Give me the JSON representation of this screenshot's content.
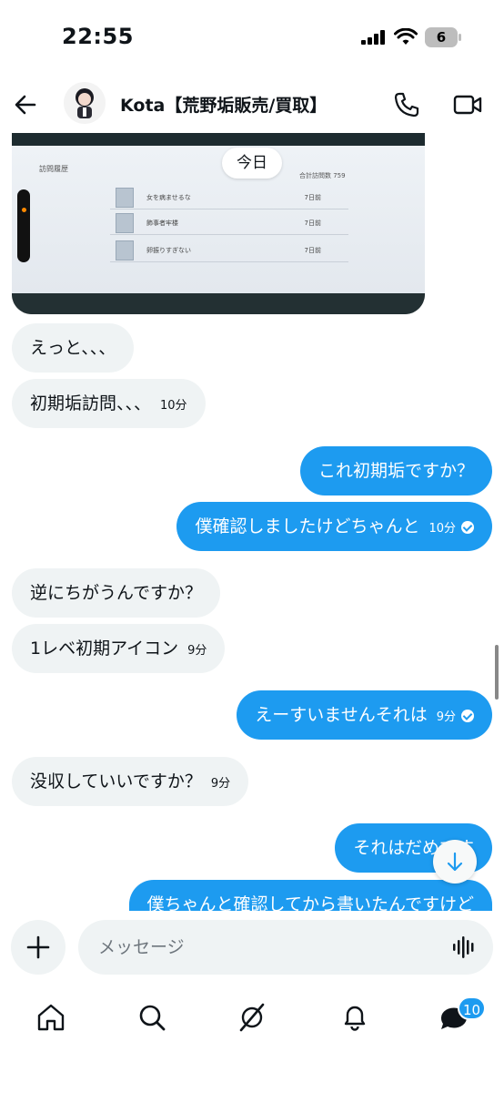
{
  "status_bar": {
    "time": "22:55",
    "battery": "6"
  },
  "header": {
    "contact_name": "Kota【荒野垢販売/買取】"
  },
  "image_message": {
    "panel_title": "訪問履歴",
    "total_label": "合計訪問数 759",
    "rows": [
      {
        "name": "女を病ませるな",
        "days": "7日前"
      },
      {
        "name": "飾事者牢楼",
        "days": "7日前"
      },
      {
        "name": "卵振りすぎない",
        "days": "7日前"
      }
    ]
  },
  "date_divider": "今日",
  "messages": [
    {
      "side": "in",
      "text": "えっと、、、",
      "time": ""
    },
    {
      "side": "in",
      "text": "初期垢訪問、、、",
      "time": "10分"
    },
    {
      "side": "out",
      "text": "これ初期垢ですか？",
      "time": ""
    },
    {
      "side": "out",
      "text": "僕確認しましたけどちゃんと",
      "time": "10分"
    },
    {
      "side": "in",
      "text": "逆にちがうんですか？",
      "time": ""
    },
    {
      "side": "in",
      "text": "1レベ初期アイコン",
      "time": "9分"
    },
    {
      "side": "out",
      "text": "えーすいませんそれは",
      "time": "9分"
    },
    {
      "side": "in",
      "text": "没収していいですか？",
      "time": "9分"
    },
    {
      "side": "out",
      "text": "それはだめです",
      "time": ""
    },
    {
      "side": "out",
      "text": "僕ちゃんと確認してから書いたんですけど",
      "time": ""
    }
  ],
  "composer": {
    "placeholder": "メッセージ"
  },
  "tabbar": {
    "icons": [
      "home-icon",
      "search-icon",
      "grok-icon",
      "notifications-icon",
      "messages-icon"
    ],
    "messages_badge": "10"
  },
  "colors": {
    "accent": "#1d9bf0",
    "incoming_bubble": "#eff3f4"
  }
}
